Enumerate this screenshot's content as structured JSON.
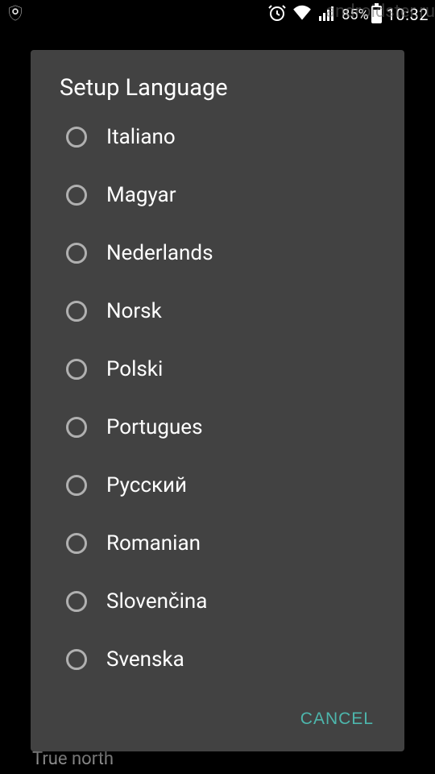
{
  "status": {
    "battery_pct": "85%",
    "time": "10:32"
  },
  "watermark": "androidster.ru",
  "background": {
    "label": "True north"
  },
  "dialog": {
    "title": "Setup Language",
    "options": [
      "Italiano",
      "Magyar",
      "Nederlands",
      "Norsk",
      "Polski",
      "Portugues",
      "Русский",
      "Romanian",
      "Slovenčina",
      "Svenska"
    ],
    "cancel": "CANCEL"
  }
}
